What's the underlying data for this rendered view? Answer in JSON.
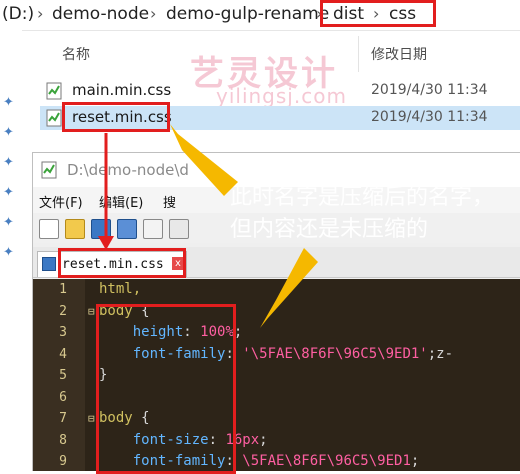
{
  "explorer": {
    "breadcrumb": {
      "drive": "(D:)",
      "segments": [
        "demo-node",
        "demo-gulp-rename",
        "dist",
        "css"
      ],
      "separator": "›"
    },
    "columns": {
      "name": "名称",
      "modified": "修改日期"
    },
    "files": [
      {
        "name": "main.min.css",
        "modified": "2019/4/30 11:34",
        "selected": false
      },
      {
        "name": "reset.min.css",
        "modified": "2019/4/30 11:34",
        "selected": true
      }
    ]
  },
  "watermark": {
    "title": "艺灵设计",
    "url": "yilingsj.com"
  },
  "editor": {
    "window_title": "D:\\demo-node\\d",
    "menu": [
      "文件(F)",
      "编辑(E)",
      "搜"
    ],
    "tab_label": "reset.min.css",
    "tab_close": "x",
    "lines": [
      {
        "n": "1",
        "fold": "",
        "tokens": [
          [
            "sel",
            "html,"
          ]
        ]
      },
      {
        "n": "2",
        "fold": "⊟",
        "tokens": [
          [
            "sel",
            "body "
          ],
          [
            "brace",
            "{"
          ]
        ]
      },
      {
        "n": "3",
        "fold": "",
        "tokens": [
          [
            "punct",
            "    "
          ],
          [
            "prop",
            "height"
          ],
          [
            "punct",
            ": "
          ],
          [
            "num",
            "100%"
          ],
          [
            "punct",
            ";"
          ]
        ]
      },
      {
        "n": "4",
        "fold": "",
        "tokens": [
          [
            "punct",
            "    "
          ],
          [
            "prop",
            "font-family"
          ],
          [
            "punct",
            ": "
          ],
          [
            "str",
            "'\\5FAE\\8F6F\\96C5\\9ED1'"
          ],
          [
            "punct",
            ";z-"
          ]
        ]
      },
      {
        "n": "5",
        "fold": "",
        "tokens": [
          [
            "brace",
            "}"
          ]
        ]
      },
      {
        "n": "6",
        "fold": "",
        "tokens": []
      },
      {
        "n": "7",
        "fold": "⊟",
        "tokens": [
          [
            "sel",
            "body "
          ],
          [
            "brace",
            "{"
          ]
        ]
      },
      {
        "n": "8",
        "fold": "",
        "tokens": [
          [
            "punct",
            "    "
          ],
          [
            "prop",
            "font-size"
          ],
          [
            "punct",
            ": "
          ],
          [
            "num",
            "16px"
          ],
          [
            "punct",
            ";"
          ]
        ]
      },
      {
        "n": "9",
        "fold": "",
        "tokens": [
          [
            "punct",
            "    "
          ],
          [
            "prop",
            "font-family"
          ],
          [
            "punct",
            ": "
          ],
          [
            "str",
            "\\5FAE\\8F6F\\96C5\\9ED1"
          ],
          [
            "punct",
            ";"
          ]
        ]
      }
    ]
  },
  "annotation": {
    "line1": "此时名字是压缩后的名字，",
    "line2": "但内容还是未压缩的"
  },
  "colors": {
    "highlight_box": "#e21e1e",
    "arrow": "#f5b800",
    "selection": "#cce4f7",
    "code_background": "#2d2418"
  }
}
